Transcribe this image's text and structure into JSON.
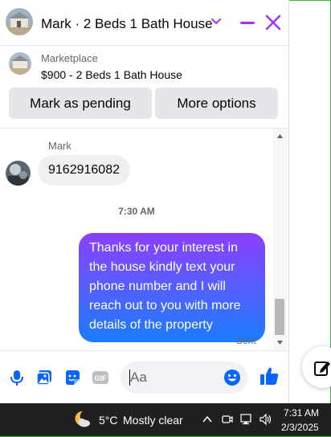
{
  "header": {
    "contact_name": "Mark",
    "separator": "·",
    "listing_title": "2 Beds 1 Bath House",
    "title": "Mark · 2 Beds 1 Bath House",
    "accent_color": "#a033ff"
  },
  "marketplace": {
    "label": "Marketplace",
    "listing": "$900 - 2 Beds 1 Bath House",
    "pending_button": "Mark as pending",
    "more_button": "More options"
  },
  "messages": {
    "sender_name": "Mark",
    "incoming_text": "9162916082",
    "timestamp": "7:30 AM",
    "outgoing_text": "Thanks for your interest in the house kindly text your phone number and I will reach out to you with more details of the property",
    "status": "Sent"
  },
  "composer": {
    "placeholder": "Aa",
    "icons": [
      "microphone-icon",
      "photo-icon",
      "sticker-icon",
      "gif-icon",
      "emoji-icon",
      "like-icon"
    ]
  },
  "taskbar": {
    "temperature": "5°C",
    "condition": "Mostly clear",
    "time": "7:31 AM",
    "date": "2/3/2025"
  }
}
